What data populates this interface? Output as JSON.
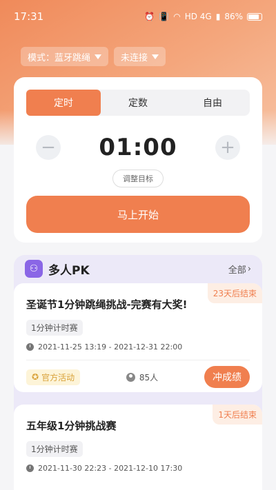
{
  "status": {
    "time": "17:31",
    "battery": "86%",
    "network": "HD 4G"
  },
  "selectors": {
    "mode": "模式：蓝牙跳绳",
    "connection": "未连接"
  },
  "tabs": [
    "定时",
    "定数",
    "自由"
  ],
  "timer": {
    "minus": "−",
    "plus": "+",
    "value": "01:00",
    "adjust_label": "调整目标"
  },
  "start_label": "马上开始",
  "pk": {
    "title": "多人PK",
    "all_label": "全部",
    "events": [
      {
        "ends": "23天后结束",
        "title": "圣诞节1分钟跳绳挑战-完赛有大奖!",
        "type": "1分钟计时赛",
        "time": "2021-11-25 13:19 - 2021-12-31 22:00",
        "official": "官方活动",
        "participants": "85人",
        "action": "冲成绩"
      },
      {
        "ends": "1天后结束",
        "title": "五年级1分钟挑战赛",
        "type": "1分钟计时赛",
        "time": "2021-11-30 22:23 - 2021-12-10 17:30"
      }
    ]
  },
  "colors": {
    "accent": "#f07f4f",
    "pk_bg": "#ece9f8"
  }
}
